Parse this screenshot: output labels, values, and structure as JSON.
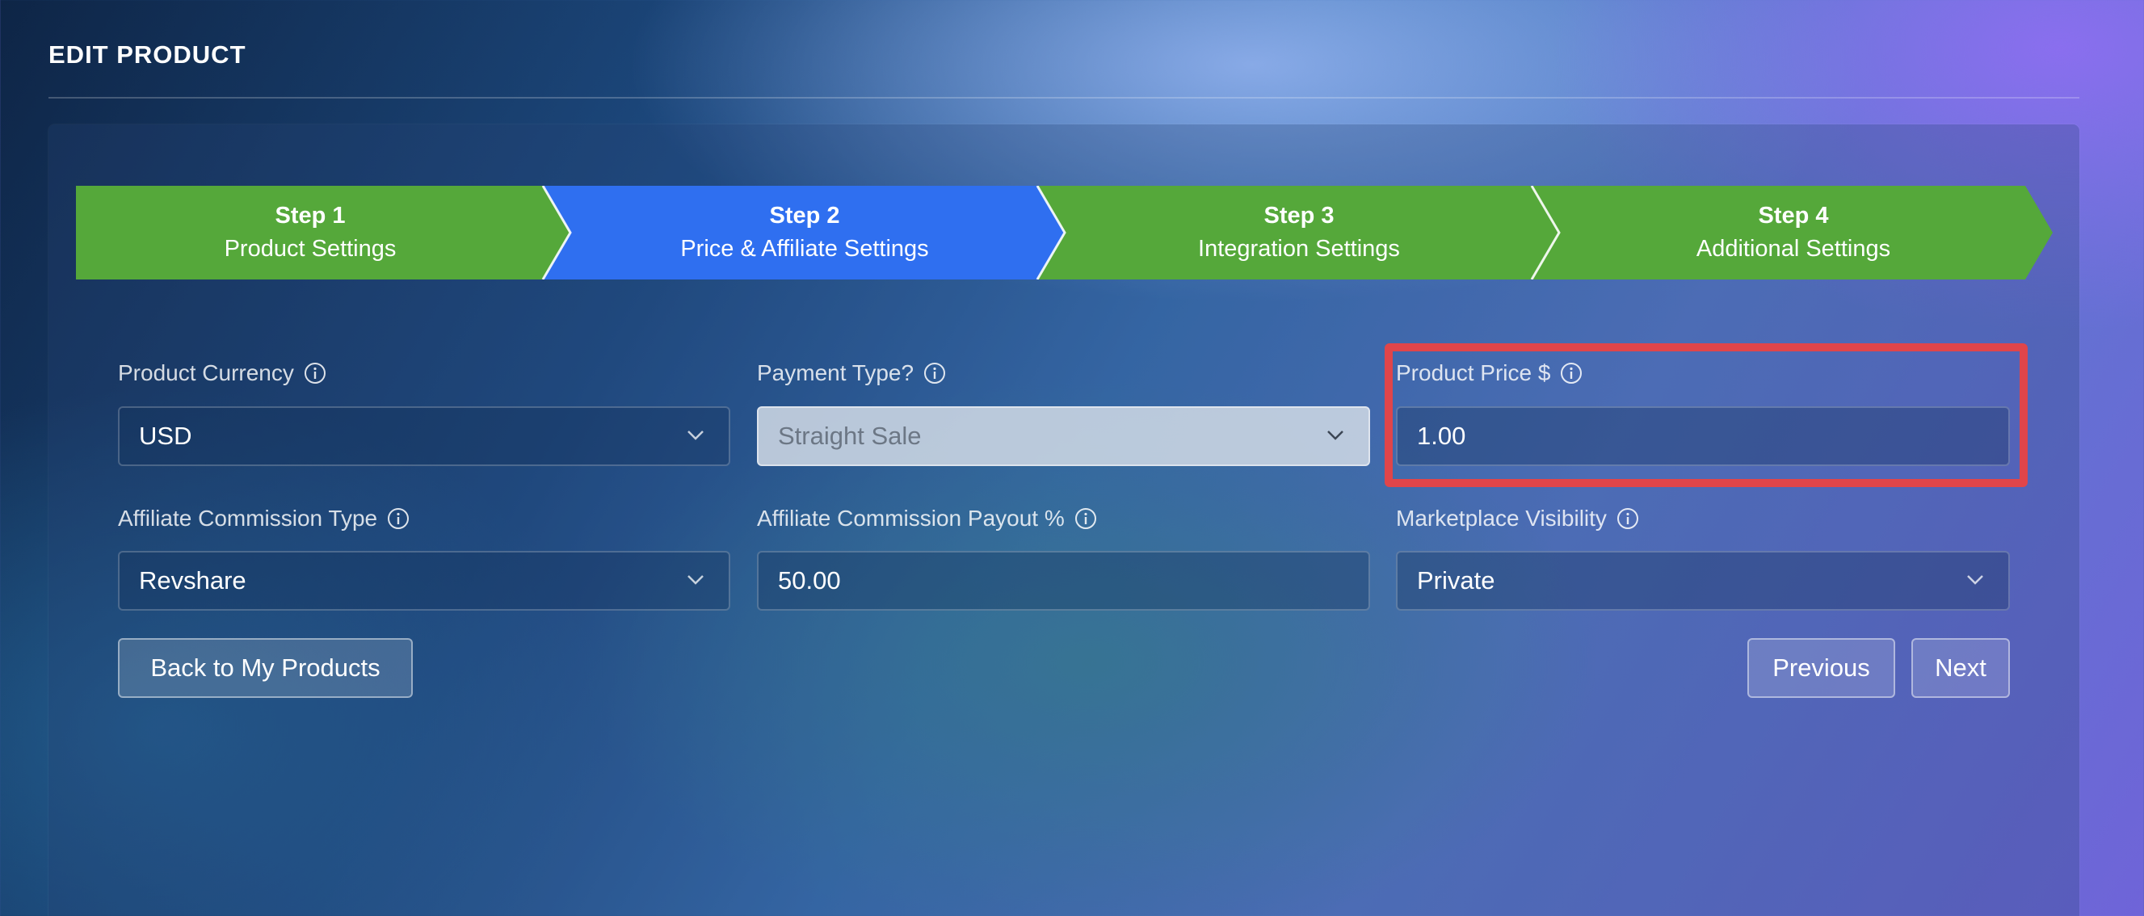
{
  "page": {
    "title": "EDIT PRODUCT"
  },
  "steps": [
    {
      "number": "Step 1",
      "name": "Product Settings",
      "color": "#55a83a",
      "active": false
    },
    {
      "number": "Step 2",
      "name": "Price & Affiliate Settings",
      "color": "#2f6ff0",
      "active": true
    },
    {
      "number": "Step 3",
      "name": "Integration Settings",
      "color": "#55a83a",
      "active": false
    },
    {
      "number": "Step 4",
      "name": "Additional Settings",
      "color": "#55a83a",
      "active": false
    }
  ],
  "form": {
    "product_currency": {
      "label": "Product Currency",
      "value": "USD",
      "icon": "info-icon"
    },
    "payment_type": {
      "label": "Payment Type?",
      "value": "Straight Sale",
      "icon": "info-icon",
      "disabled": true
    },
    "product_price": {
      "label": "Product Price $",
      "value": "1.00",
      "icon": "info-icon",
      "highlighted": true
    },
    "affiliate_commission_type": {
      "label": "Affiliate Commission Type",
      "value": "Revshare",
      "icon": "info-icon"
    },
    "affiliate_commission_payout": {
      "label": "Affiliate Commission Payout %",
      "value": "50.00",
      "icon": "info-icon"
    },
    "marketplace_visibility": {
      "label": "Marketplace Visibility",
      "value": "Private",
      "icon": "info-icon"
    }
  },
  "buttons": {
    "back": "Back to My Products",
    "previous": "Previous",
    "next": "Next"
  },
  "colors": {
    "step_complete": "#55a83a",
    "step_active": "#2f6ff0",
    "highlight": "#e0454a"
  }
}
